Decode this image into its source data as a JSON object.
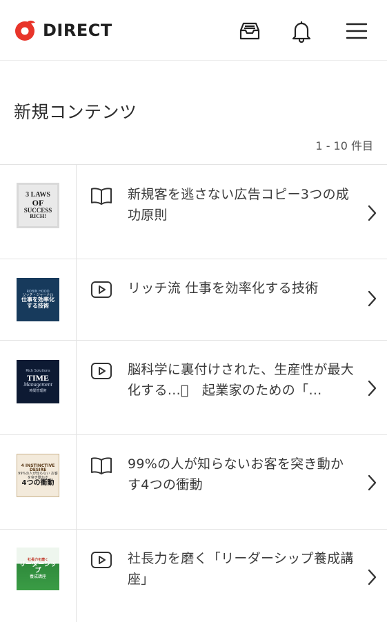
{
  "header": {
    "logo_text": "DIRECT",
    "icons": {
      "logo": "direct-logo-icon",
      "inbox": "inbox-icon",
      "notifications": "bell-icon",
      "menu": "hamburger-menu-icon"
    },
    "brand_color": "#e8342a"
  },
  "section": {
    "title": "新規コンテンツ",
    "count": "1 - 10 件目"
  },
  "items": [
    {
      "type_icon": "book-icon",
      "title": "新規客を逃さない広告コピー3つの成功原則",
      "thumb": {
        "l1": "3 LAWS",
        "l2": "OF",
        "l3": "SUCCESS",
        "l4": "RICH!"
      }
    },
    {
      "type_icon": "video-play-icon",
      "title": "リッチ流 仕事を効率化する技術",
      "thumb": {
        "s": "ROBIN HOOD",
        "m1": "リッチ・ジャーナル",
        "m2": "仕事を効率化",
        "m3": "する技術"
      }
    },
    {
      "type_icon": "video-play-icon",
      "title": "脳科学に裏付けされた、生産性が最大化する...\u0000　起業家のための「…",
      "thumb": {
        "s": "Rich Solutions",
        "big": "TIME",
        "it": "Management",
        "ft": "時間管理術"
      }
    },
    {
      "type_icon": "book-icon",
      "title": "99%の人が知らないお客を突き動かす4つの衝動",
      "thumb": {
        "a": "4 INSTINCTIVE DESIRE",
        "b": "99%の人が知らない お客を突き動かす",
        "c": "4つの衝動"
      }
    },
    {
      "type_icon": "video-play-icon",
      "title": "社長力を磨く「リーダーシップ養成講座」",
      "thumb": {
        "a": "社長力を磨く",
        "b": "リーダーシップ",
        "c": "養成講座"
      }
    }
  ]
}
